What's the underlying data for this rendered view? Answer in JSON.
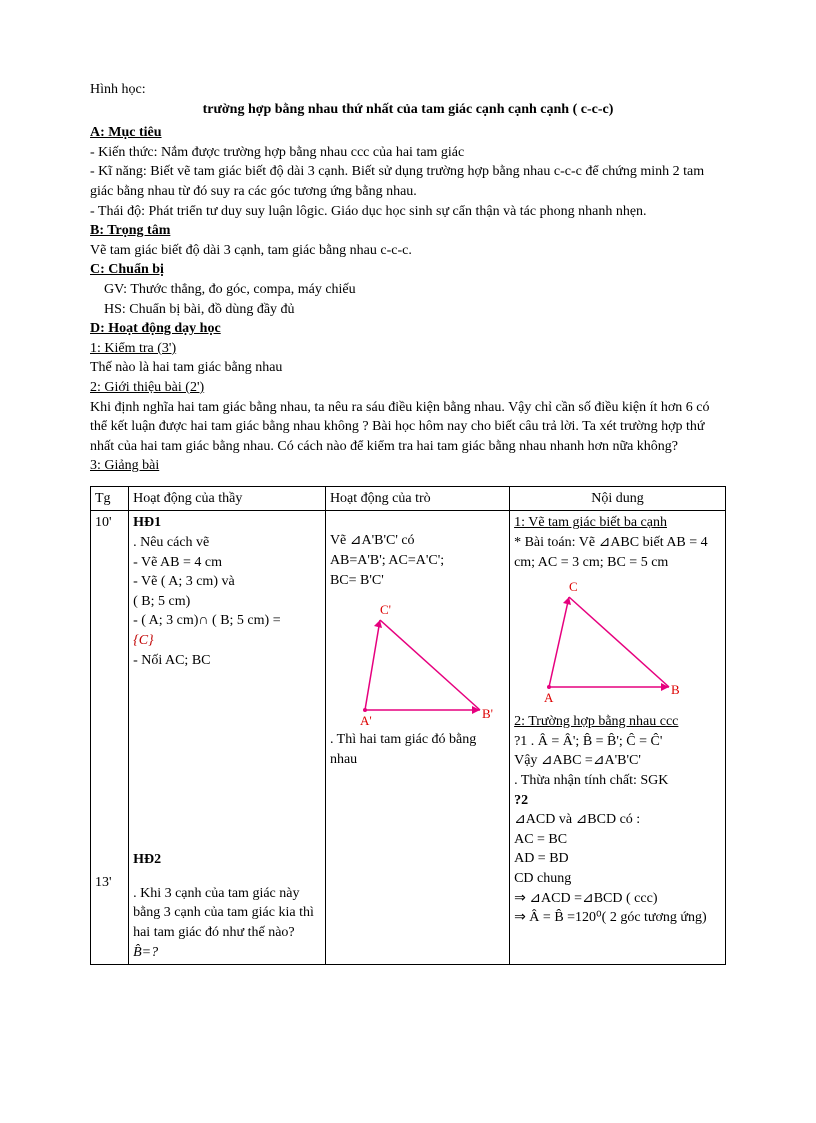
{
  "header": {
    "subject": "Hình học:",
    "title": "trường hợp bằng nhau thứ nhất của tam giác cạnh cạnh cạnh ( c-c-c)"
  },
  "sectionA": {
    "label": "A: Mục tiêu",
    "kienthuc": "- Kiến thức: Nắm được trường hợp bằng nhau ccc của hai tam giác",
    "kinang": "- Kĩ năng: Biết vẽ tam giác biết độ dài 3 cạnh. Biết sử dụng trường hợp bằng nhau c-c-c để chứng minh 2 tam giác bằng nhau từ đó suy ra các góc tương ứng bằng nhau.",
    "thaido": "- Thái độ: Phát triển tư duy suy luận lôgic. Giáo dục học sinh sự cẩn thận và tác phong nhanh nhẹn."
  },
  "sectionB": {
    "label": "B: Trọng tâm",
    "content": " Vẽ tam giác biết độ dài 3 cạnh, tam giác bằng nhau c-c-c."
  },
  "sectionC": {
    "label": " C: Chuẩn bị",
    "gv": "GV: Thước thẳng, đo góc, compa, máy chiếu",
    "hs": "HS: Chuẩn bị bài, đồ dùng đầy đủ"
  },
  "sectionD": {
    "label": "D: Hoạt động dạy học",
    "item1label": "1: Kiểm tra (3')",
    "item1text": "Thế nào là hai tam giác bằng nhau",
    "item2label": "2: Giới thiệu bài (2')",
    "item2text": "Khi định nghĩa hai tam giác bằng nhau, ta nêu ra sáu điều kiện bằng nhau. Vậy chỉ cần số điều kiện ít hơn 6 có thể kết luận được hai tam giác bằng nhau không ? Bài học hôm nay cho biết câu trả lời. Ta xét trường hợp thứ nhất của hai tam giác bằng nhau. Có cách nào để kiểm tra hai tam giác bằng nhau nhanh hơn nữa không?",
    "item3label": "3: Giảng bài"
  },
  "table": {
    "headers": {
      "tg": "Tg",
      "thay": "Hoạt động của thầy",
      "tro": "Hoạt động của trò",
      "noidung": "Nội dung"
    },
    "row": {
      "tg1": "10'",
      "tg2": "13'",
      "hd1_label": "HĐ1",
      "hd1_line1": ". Nêu cách vẽ",
      "hd1_line2": "- Vẽ AB = 4 cm",
      "hd1_line3": "- Vẽ ( A; 3 cm) và",
      "hd1_line4": "( B; 5 cm)",
      "hd1_line5_pre": "- ( A; 3 cm)",
      "hd1_line5_cap": "∩",
      "hd1_line5_post": " ( B; 5 cm) =",
      "hd1_line6": "{C}",
      "hd1_line7": "- Nối AC; BC",
      "hd2_label": "HĐ2",
      "hd2_text1": ". Khi 3 cạnh của tam giác này bằng 3 cạnh của tam giác kia thì hai tam giác đó như thế nào?",
      "hd2_text2": "B̂=?",
      "tro_line1": "Vẽ ⊿A'B'C' có",
      "tro_line2": "AB=A'B'; AC=A'C';",
      "tro_line3": "BC= B'C'",
      "tro_end": ". Thì hai tam giác đó bằng nhau",
      "tri_labels": {
        "C": "C'",
        "A": "A'",
        "B": "B'"
      },
      "nd_head1": "1: Vẽ tam giác biết ba cạnh",
      "nd_text1": "* Bài toán: Vẽ ⊿ABC biết AB = 4 cm; AC = 3 cm; BC = 5 cm",
      "nd_tri_labels": {
        "C": "C",
        "A": "A",
        "B": "B"
      },
      "nd_head2": "2: Trường hợp bằng nhau ccc",
      "nd_q1": "?1 . Â = Â'; B̂ = B̂'; Ĉ = Ĉ'",
      "nd_q1b": "Vậy ⊿ABC =⊿A'B'C'",
      "nd_q1c": ". Thừa nhận tính chất: SGK",
      "nd_q2": "?2",
      "nd_q2a": "⊿ACD và ⊿BCD có :",
      "nd_q2b": "AC = BC",
      "nd_q2c": "AD = BD",
      "nd_q2d": "CD chung",
      "nd_q2e": "⇒ ⊿ACD =⊿BCD ( ccc)",
      "nd_q2f": "⇒ Â = B̂ =120⁰( 2 góc tương ứng)"
    }
  }
}
